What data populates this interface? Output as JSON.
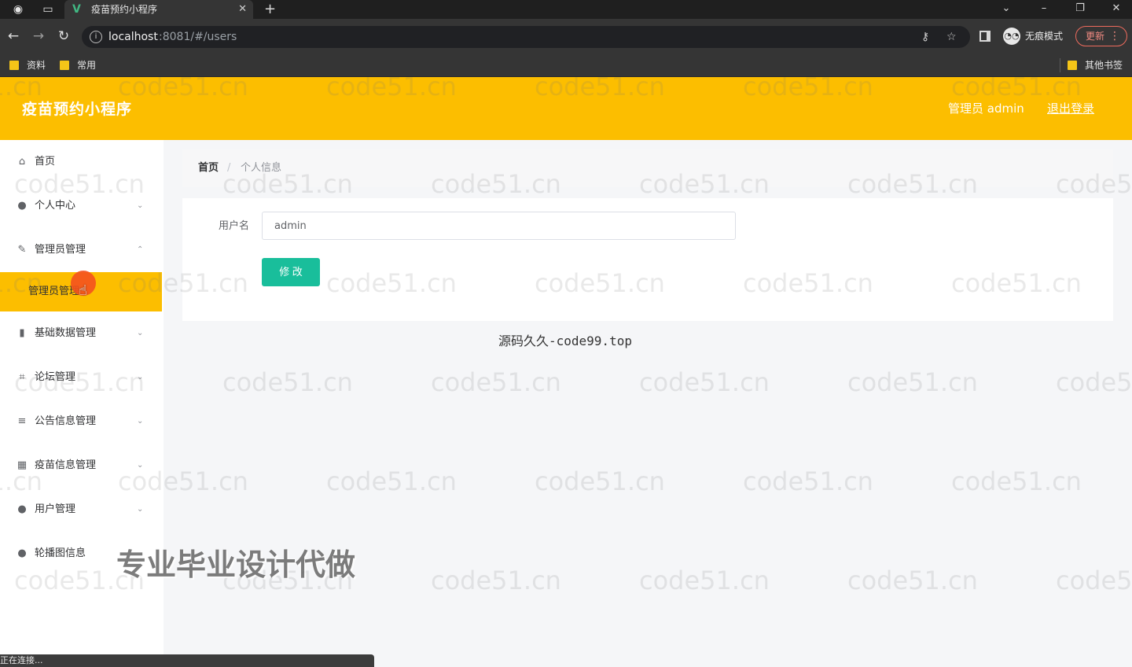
{
  "browser": {
    "tab_title": "疫苗预约小程序",
    "tab_logo": "V",
    "url_host": "localhost",
    "url_rest": ":8081/#/users",
    "incognito_label": "无痕模式",
    "update_label": "更新",
    "bookmarks": [
      "资料",
      "常用"
    ],
    "other_bookmarks": "其他书签",
    "status_text": "正在连接..."
  },
  "app": {
    "title": "疫苗预约小程序",
    "admin_label": "管理员 admin",
    "logout_label": "退出登录",
    "brand_color": "#fcbe00",
    "accent_color": "#19be9b"
  },
  "sidebar": {
    "items": [
      {
        "label": "首页",
        "icon": "home-icon"
      },
      {
        "label": "个人中心",
        "icon": "user-icon"
      },
      {
        "label": "管理员管理",
        "icon": "edit-icon"
      },
      {
        "label": "基础数据管理",
        "icon": "bar-chart-icon"
      },
      {
        "label": "论坛管理",
        "icon": "crop-icon"
      },
      {
        "label": "公告信息管理",
        "icon": "list-icon"
      },
      {
        "label": "疫苗信息管理",
        "icon": "grid-icon"
      },
      {
        "label": "用户管理",
        "icon": "user-icon"
      },
      {
        "label": "轮播图信息",
        "icon": "user-icon"
      }
    ],
    "active_submenu": "管理员管理"
  },
  "breadcrumb": {
    "home": "首页",
    "separator": "/",
    "current": "个人信息"
  },
  "form": {
    "username_label": "用户名",
    "username_value": "admin",
    "submit_label": "修 改"
  },
  "overlay": {
    "note": "源码久久-code99.top",
    "promo": "专业毕业设计代做",
    "watermark": "code51.cn"
  }
}
